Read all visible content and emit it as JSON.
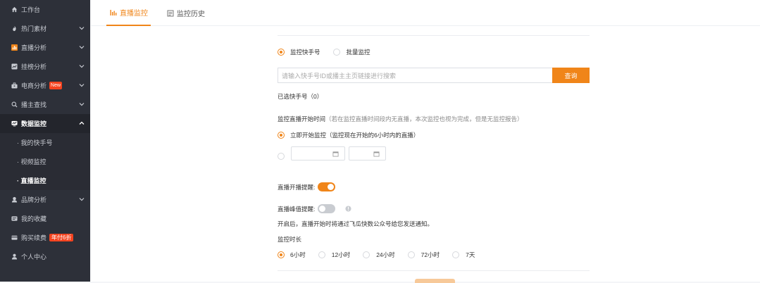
{
  "sidebar": {
    "items": [
      {
        "label": "工作台",
        "icon": "home-icon"
      },
      {
        "label": "热门素材",
        "icon": "fire-icon"
      },
      {
        "label": "直播分析",
        "icon": "live-chart-icon"
      },
      {
        "label": "挂榜分析",
        "icon": "rank-chart-icon"
      },
      {
        "label": "电商分析",
        "icon": "shop-icon",
        "badge": "New"
      },
      {
        "label": "播主查找",
        "icon": "search-icon"
      },
      {
        "label": "数据监控",
        "icon": "monitor-icon"
      },
      {
        "label": "· 我的快手号"
      },
      {
        "label": "· 视频监控"
      },
      {
        "label": "· 直播监控"
      },
      {
        "label": "品牌分析",
        "icon": "brand-icon"
      },
      {
        "label": "我的收藏",
        "icon": "favorite-icon"
      },
      {
        "label": "购买续费",
        "icon": "card-icon",
        "badge": "年付6折"
      },
      {
        "label": "个人中心",
        "icon": "user-icon"
      }
    ]
  },
  "tabs": {
    "live": "直播监控",
    "history": "监控历史"
  },
  "form": {
    "mode_options": [
      "监控快手号",
      "批量监控"
    ],
    "search_placeholder": "请输入快手号ID或播主主页链接进行搜索",
    "search_button": "查询",
    "selected_label": "已选快手号（0）",
    "start_time_title": "监控直播开始时间",
    "start_time_hint": "（若在监控直播时间段内无直播，本次监控也视为完成，但是无监控报告）",
    "start_now": "立即开始监控",
    "start_now_hint": "（监控现在开始的6小时内的直播）",
    "live_start_alert": "直播开播提醒:",
    "live_peak_alert": "直播峰值提醒:",
    "notify_text": "开启后，直播开始时将通过飞瓜快数公众号给您发送通知。",
    "duration_title": "监控时长",
    "durations": [
      "6小时",
      "12小时",
      "24小时",
      "72小时",
      "7天"
    ]
  },
  "colors": {
    "accent": "#f08519",
    "sidebar_bg": "#2d3039",
    "badge": "#f5431f"
  }
}
